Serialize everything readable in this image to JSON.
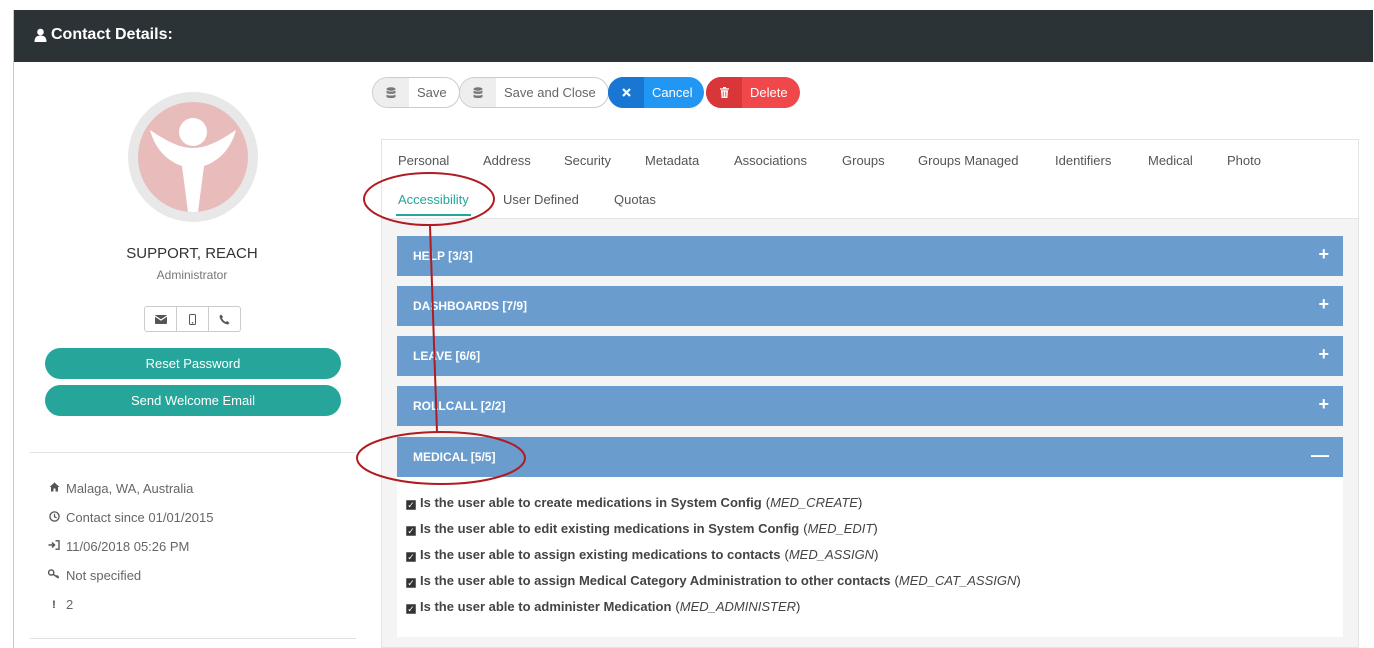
{
  "header": {
    "title": "Contact Details:"
  },
  "profile": {
    "name": "SUPPORT, REACH",
    "role": "Administrator",
    "reset_label": "Reset Password",
    "welcome_label": "Send Welcome Email",
    "location": "Malaga, WA, Australia",
    "contact_since": "Contact since 01/01/2015",
    "last_login": "11/06/2018 05:26 PM",
    "key": "Not specified",
    "alerts": "2"
  },
  "toolbar": {
    "save_label": "Save",
    "save_close_label": "Save and Close",
    "cancel_label": "Cancel",
    "delete_label": "Delete"
  },
  "tabs": [
    "Personal",
    "Address",
    "Security",
    "Metadata",
    "Associations",
    "Groups",
    "Groups Managed",
    "Identifiers",
    "Medical",
    "Photo",
    "Accessibility",
    "User Defined",
    "Quotas"
  ],
  "active_tab": "Accessibility",
  "sections": [
    {
      "label": "HELP [3/3]",
      "expanded": false
    },
    {
      "label": "DASHBOARDS [7/9]",
      "expanded": false
    },
    {
      "label": "LEAVE [6/6]",
      "expanded": false
    },
    {
      "label": "ROLLCALL [2/2]",
      "expanded": false
    },
    {
      "label": "MEDICAL [5/5]",
      "expanded": true
    }
  ],
  "medical_permissions": [
    {
      "text": "Is the user able to create medications in System Config",
      "code": "MED_CREATE",
      "checked": true
    },
    {
      "text": "Is the user able to edit existing medications in System Config",
      "code": "MED_EDIT",
      "checked": true
    },
    {
      "text": "Is the user able to assign existing medications to contacts",
      "code": "MED_ASSIGN",
      "checked": true
    },
    {
      "text": "Is the user able to assign Medical Category Administration to other contacts",
      "code": "MED_CAT_ASSIGN",
      "checked": true
    },
    {
      "text": "Is the user able to administer Medication",
      "code": "MED_ADMINISTER",
      "checked": true
    }
  ],
  "colors": {
    "header_bg": "#2c3337",
    "accent_green": "#26a69a",
    "accordion_blue": "#6a9cce",
    "cancel_blue": "#2196f3",
    "delete_red": "#f0474a",
    "annotation_red": "#b01c22"
  },
  "icons": {
    "header": "user-icon",
    "save": "database-icon",
    "cancel": "times-icon",
    "delete": "trash-icon"
  }
}
